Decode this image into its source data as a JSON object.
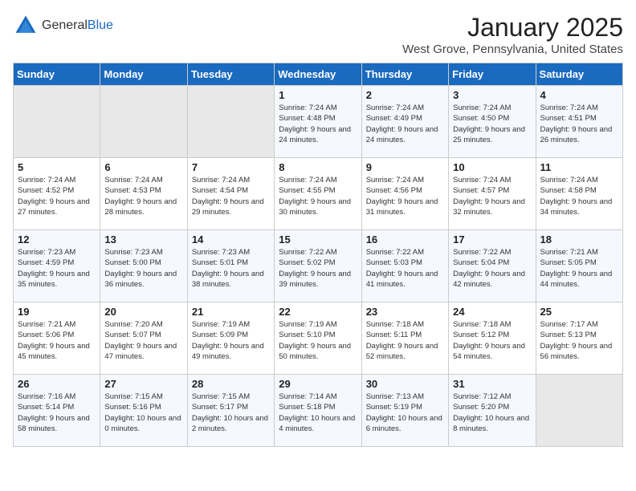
{
  "header": {
    "logo_general": "General",
    "logo_blue": "Blue",
    "title": "January 2025",
    "subtitle": "West Grove, Pennsylvania, United States"
  },
  "days_of_week": [
    "Sunday",
    "Monday",
    "Tuesday",
    "Wednesday",
    "Thursday",
    "Friday",
    "Saturday"
  ],
  "weeks": [
    [
      {
        "day": "",
        "sunrise": "",
        "sunset": "",
        "daylight": "",
        "empty": true
      },
      {
        "day": "",
        "sunrise": "",
        "sunset": "",
        "daylight": "",
        "empty": true
      },
      {
        "day": "",
        "sunrise": "",
        "sunset": "",
        "daylight": "",
        "empty": true
      },
      {
        "day": "1",
        "sunrise": "Sunrise: 7:24 AM",
        "sunset": "Sunset: 4:48 PM",
        "daylight": "Daylight: 9 hours and 24 minutes.",
        "empty": false
      },
      {
        "day": "2",
        "sunrise": "Sunrise: 7:24 AM",
        "sunset": "Sunset: 4:49 PM",
        "daylight": "Daylight: 9 hours and 24 minutes.",
        "empty": false
      },
      {
        "day": "3",
        "sunrise": "Sunrise: 7:24 AM",
        "sunset": "Sunset: 4:50 PM",
        "daylight": "Daylight: 9 hours and 25 minutes.",
        "empty": false
      },
      {
        "day": "4",
        "sunrise": "Sunrise: 7:24 AM",
        "sunset": "Sunset: 4:51 PM",
        "daylight": "Daylight: 9 hours and 26 minutes.",
        "empty": false
      }
    ],
    [
      {
        "day": "5",
        "sunrise": "Sunrise: 7:24 AM",
        "sunset": "Sunset: 4:52 PM",
        "daylight": "Daylight: 9 hours and 27 minutes.",
        "empty": false
      },
      {
        "day": "6",
        "sunrise": "Sunrise: 7:24 AM",
        "sunset": "Sunset: 4:53 PM",
        "daylight": "Daylight: 9 hours and 28 minutes.",
        "empty": false
      },
      {
        "day": "7",
        "sunrise": "Sunrise: 7:24 AM",
        "sunset": "Sunset: 4:54 PM",
        "daylight": "Daylight: 9 hours and 29 minutes.",
        "empty": false
      },
      {
        "day": "8",
        "sunrise": "Sunrise: 7:24 AM",
        "sunset": "Sunset: 4:55 PM",
        "daylight": "Daylight: 9 hours and 30 minutes.",
        "empty": false
      },
      {
        "day": "9",
        "sunrise": "Sunrise: 7:24 AM",
        "sunset": "Sunset: 4:56 PM",
        "daylight": "Daylight: 9 hours and 31 minutes.",
        "empty": false
      },
      {
        "day": "10",
        "sunrise": "Sunrise: 7:24 AM",
        "sunset": "Sunset: 4:57 PM",
        "daylight": "Daylight: 9 hours and 32 minutes.",
        "empty": false
      },
      {
        "day": "11",
        "sunrise": "Sunrise: 7:24 AM",
        "sunset": "Sunset: 4:58 PM",
        "daylight": "Daylight: 9 hours and 34 minutes.",
        "empty": false
      }
    ],
    [
      {
        "day": "12",
        "sunrise": "Sunrise: 7:23 AM",
        "sunset": "Sunset: 4:59 PM",
        "daylight": "Daylight: 9 hours and 35 minutes.",
        "empty": false
      },
      {
        "day": "13",
        "sunrise": "Sunrise: 7:23 AM",
        "sunset": "Sunset: 5:00 PM",
        "daylight": "Daylight: 9 hours and 36 minutes.",
        "empty": false
      },
      {
        "day": "14",
        "sunrise": "Sunrise: 7:23 AM",
        "sunset": "Sunset: 5:01 PM",
        "daylight": "Daylight: 9 hours and 38 minutes.",
        "empty": false
      },
      {
        "day": "15",
        "sunrise": "Sunrise: 7:22 AM",
        "sunset": "Sunset: 5:02 PM",
        "daylight": "Daylight: 9 hours and 39 minutes.",
        "empty": false
      },
      {
        "day": "16",
        "sunrise": "Sunrise: 7:22 AM",
        "sunset": "Sunset: 5:03 PM",
        "daylight": "Daylight: 9 hours and 41 minutes.",
        "empty": false
      },
      {
        "day": "17",
        "sunrise": "Sunrise: 7:22 AM",
        "sunset": "Sunset: 5:04 PM",
        "daylight": "Daylight: 9 hours and 42 minutes.",
        "empty": false
      },
      {
        "day": "18",
        "sunrise": "Sunrise: 7:21 AM",
        "sunset": "Sunset: 5:05 PM",
        "daylight": "Daylight: 9 hours and 44 minutes.",
        "empty": false
      }
    ],
    [
      {
        "day": "19",
        "sunrise": "Sunrise: 7:21 AM",
        "sunset": "Sunset: 5:06 PM",
        "daylight": "Daylight: 9 hours and 45 minutes.",
        "empty": false
      },
      {
        "day": "20",
        "sunrise": "Sunrise: 7:20 AM",
        "sunset": "Sunset: 5:07 PM",
        "daylight": "Daylight: 9 hours and 47 minutes.",
        "empty": false
      },
      {
        "day": "21",
        "sunrise": "Sunrise: 7:19 AM",
        "sunset": "Sunset: 5:09 PM",
        "daylight": "Daylight: 9 hours and 49 minutes.",
        "empty": false
      },
      {
        "day": "22",
        "sunrise": "Sunrise: 7:19 AM",
        "sunset": "Sunset: 5:10 PM",
        "daylight": "Daylight: 9 hours and 50 minutes.",
        "empty": false
      },
      {
        "day": "23",
        "sunrise": "Sunrise: 7:18 AM",
        "sunset": "Sunset: 5:11 PM",
        "daylight": "Daylight: 9 hours and 52 minutes.",
        "empty": false
      },
      {
        "day": "24",
        "sunrise": "Sunrise: 7:18 AM",
        "sunset": "Sunset: 5:12 PM",
        "daylight": "Daylight: 9 hours and 54 minutes.",
        "empty": false
      },
      {
        "day": "25",
        "sunrise": "Sunrise: 7:17 AM",
        "sunset": "Sunset: 5:13 PM",
        "daylight": "Daylight: 9 hours and 56 minutes.",
        "empty": false
      }
    ],
    [
      {
        "day": "26",
        "sunrise": "Sunrise: 7:16 AM",
        "sunset": "Sunset: 5:14 PM",
        "daylight": "Daylight: 9 hours and 58 minutes.",
        "empty": false
      },
      {
        "day": "27",
        "sunrise": "Sunrise: 7:15 AM",
        "sunset": "Sunset: 5:16 PM",
        "daylight": "Daylight: 10 hours and 0 minutes.",
        "empty": false
      },
      {
        "day": "28",
        "sunrise": "Sunrise: 7:15 AM",
        "sunset": "Sunset: 5:17 PM",
        "daylight": "Daylight: 10 hours and 2 minutes.",
        "empty": false
      },
      {
        "day": "29",
        "sunrise": "Sunrise: 7:14 AM",
        "sunset": "Sunset: 5:18 PM",
        "daylight": "Daylight: 10 hours and 4 minutes.",
        "empty": false
      },
      {
        "day": "30",
        "sunrise": "Sunrise: 7:13 AM",
        "sunset": "Sunset: 5:19 PM",
        "daylight": "Daylight: 10 hours and 6 minutes.",
        "empty": false
      },
      {
        "day": "31",
        "sunrise": "Sunrise: 7:12 AM",
        "sunset": "Sunset: 5:20 PM",
        "daylight": "Daylight: 10 hours and 8 minutes.",
        "empty": false
      },
      {
        "day": "",
        "sunrise": "",
        "sunset": "",
        "daylight": "",
        "empty": true
      }
    ]
  ]
}
